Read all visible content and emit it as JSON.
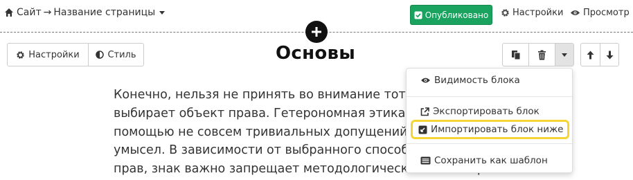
{
  "topbar": {
    "breadcrumb_site": "Сайт",
    "breadcrumb_arrow": "→",
    "breadcrumb_page": "Название страницы",
    "published_label": "Опубликовано",
    "settings_label": "Настройки",
    "preview_label": "Просмотр"
  },
  "block_toolbar": {
    "settings_label": "Настройки",
    "style_label": "Стиль"
  },
  "block": {
    "title": "Основы",
    "paragraph_lines": [
      "Конечно, нельзя не принять во внимание тот фак",
      "выбирает объект права. Гетерономная этика, как",
      "помощью не совсем тривиальных допущений, тр",
      "умысел. В зависимости от выбранного способа за",
      "прав, знак важно запрещает методологический язык образов."
    ]
  },
  "dropdown": {
    "items": [
      {
        "label": "Видимость блока",
        "icon": "eye-icon"
      },
      {
        "label": "Экспортировать блок",
        "icon": "external-link-icon"
      },
      {
        "label": "Импортировать блок ниже",
        "icon": "import-icon",
        "highlighted": true
      },
      {
        "label": "Сохранить как шаблон",
        "icon": "template-icon"
      }
    ]
  },
  "colors": {
    "published_bg": "#19a35e",
    "highlight_border": "#f5d533",
    "title": "#111111"
  }
}
